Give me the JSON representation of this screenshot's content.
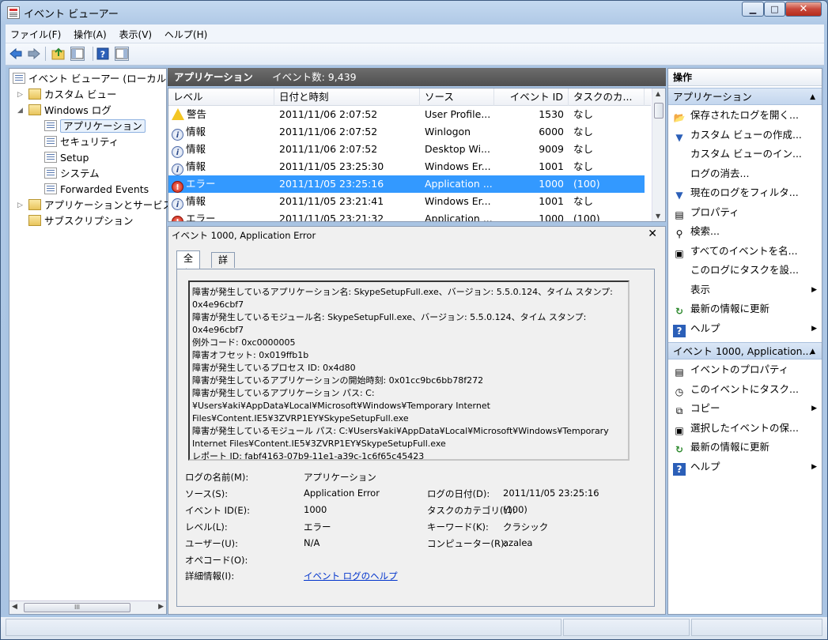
{
  "window": {
    "title": "イベント ビューアー",
    "min": "▁",
    "max": "□",
    "close": "✕"
  },
  "menu": [
    "ファイル(F)",
    "操作(A)",
    "表示(V)",
    "ヘルプ(H)"
  ],
  "toolbar": {
    "icons": [
      "back-icon",
      "forward-icon",
      "up-folder-icon",
      "show-hide-tree-icon",
      "help-icon",
      "show-hide-action-icon"
    ]
  },
  "tree": {
    "root": "イベント ビューアー (ローカル",
    "custom_views": "カスタム ビュー",
    "windows_logs": "Windows ログ",
    "application": "アプリケーション",
    "security": "セキュリティ",
    "setup": "Setup",
    "system": "システム",
    "forwarded": "Forwarded Events",
    "apps_services": "アプリケーションとサービス",
    "subscriptions": "サブスクリプション",
    "scroll_thumb": "III"
  },
  "list": {
    "header_title": "アプリケーション",
    "header_count": "イベント数: 9,439",
    "columns": [
      "レベル",
      "日付と時刻",
      "ソース",
      "イベント ID",
      "タスクのカ..."
    ],
    "rows": [
      {
        "level": "警告",
        "icon": "warning-icon",
        "date": "2011/11/06 2:07:52",
        "source": "User Profile...",
        "id": "1530",
        "task": "なし"
      },
      {
        "level": "情報",
        "icon": "info-icon",
        "date": "2011/11/06 2:07:52",
        "source": "Winlogon",
        "id": "6000",
        "task": "なし"
      },
      {
        "level": "情報",
        "icon": "info-icon",
        "date": "2011/11/06 2:07:52",
        "source": "Desktop Wi...",
        "id": "9009",
        "task": "なし"
      },
      {
        "level": "情報",
        "icon": "info-icon",
        "date": "2011/11/05 23:25:30",
        "source": "Windows Er...",
        "id": "1001",
        "task": "なし"
      },
      {
        "level": "エラー",
        "icon": "error-icon",
        "date": "2011/11/05 23:25:16",
        "source": "Application ...",
        "id": "1000",
        "task": "(100)"
      },
      {
        "level": "情報",
        "icon": "info-icon",
        "date": "2011/11/05 23:21:41",
        "source": "Windows Er...",
        "id": "1001",
        "task": "なし"
      },
      {
        "level": "エラー",
        "icon": "error-icon",
        "date": "2011/11/05 23:21:32",
        "source": "Application ...",
        "id": "1000",
        "task": "(100)"
      }
    ]
  },
  "detail": {
    "title": "イベント 1000, Application Error",
    "close": "✕",
    "tab_general": "全般",
    "tab_details": "詳細",
    "description": "障害が発生しているアプリケーション名: SkypeSetupFull.exe、バージョン: 5.5.0.124、タイム スタンプ: 0x4e96cbf7\n障害が発生しているモジュール名: SkypeSetupFull.exe、バージョン: 5.5.0.124、タイム スタンプ: 0x4e96cbf7\n例外コード: 0xc0000005\n障害オフセット: 0x019ffb1b\n障害が発生しているプロセス ID: 0x4d80\n障害が発生しているアプリケーションの開始時刻: 0x01cc9bc6bb78f272\n障害が発生しているアプリケーション パス: C:¥Users¥aki¥AppData¥Local¥Microsoft¥Windows¥Temporary Internet Files¥Content.IE5¥3ZVRP1EY¥SkypeSetupFull.exe\n障害が発生しているモジュール パス: C:¥Users¥aki¥AppData¥Local¥Microsoft¥Windows¥Temporary Internet Files¥Content.IE5¥3ZVRP1EY¥SkypeSetupFull.exe\nレポート ID: fabf4163-07b9-11e1-a39c-1c6f65c45423",
    "log_name_label": "ログの名前(M):",
    "log_name": "アプリケーション",
    "source_label": "ソース(S):",
    "source": "Application Error",
    "logged_label": "ログの日付(D):",
    "logged": "2011/11/05 23:25:16",
    "event_id_label": "イベント ID(E):",
    "event_id": "1000",
    "task_label": "タスクのカテゴリ(Y):",
    "task": "(100)",
    "level_label": "レベル(L):",
    "level": "エラー",
    "keywords_label": "キーワード(K):",
    "keywords": "クラシック",
    "user_label": "ユーザー(U):",
    "user": "N/A",
    "computer_label": "コンピューター(R):",
    "computer": "azalea",
    "opcode_label": "オペコード(O):",
    "more_info_label": "詳細情報(I):",
    "more_info_link": "イベント ログのヘルプ"
  },
  "actions": {
    "header": "操作",
    "section1": "アプリケーション",
    "items1": [
      {
        "label": "保存されたログを開く...",
        "icon": "open-folder-icon",
        "glyph": "📂",
        "sub": false
      },
      {
        "label": "カスタム ビューの作成...",
        "icon": "filter-icon",
        "glyph": "▼",
        "sub": false
      },
      {
        "label": "カスタム ビューのイン...",
        "icon": "",
        "glyph": "",
        "sub": false
      },
      {
        "label": "ログの消去...",
        "icon": "",
        "glyph": "",
        "sub": false
      },
      {
        "label": "現在のログをフィルタ...",
        "icon": "filter-icon",
        "glyph": "▼",
        "sub": false
      },
      {
        "label": "プロパティ",
        "icon": "properties-icon",
        "glyph": "▤",
        "sub": false
      },
      {
        "label": "検索...",
        "icon": "binoculars-icon",
        "glyph": "⚲",
        "sub": false
      },
      {
        "label": "すべてのイベントを名...",
        "icon": "save-icon",
        "glyph": "▣",
        "sub": false
      },
      {
        "label": "このログにタスクを設...",
        "icon": "",
        "glyph": "",
        "sub": false
      },
      {
        "label": "表示",
        "icon": "",
        "glyph": "",
        "sub": true
      },
      {
        "label": "最新の情報に更新",
        "icon": "refresh-icon",
        "glyph": "↻",
        "sub": false
      },
      {
        "label": "ヘルプ",
        "icon": "help-icon",
        "glyph": "?",
        "sub": true
      }
    ],
    "section2": "イベント 1000, Application...",
    "items2": [
      {
        "label": "イベントのプロパティ",
        "icon": "properties-icon",
        "glyph": "▤",
        "sub": false
      },
      {
        "label": "このイベントにタスク...",
        "icon": "task-icon",
        "glyph": "◷",
        "sub": false
      },
      {
        "label": "コピー",
        "icon": "copy-icon",
        "glyph": "⧉",
        "sub": true
      },
      {
        "label": "選択したイベントの保...",
        "icon": "save-icon",
        "glyph": "▣",
        "sub": false
      },
      {
        "label": "最新の情報に更新",
        "icon": "refresh-icon",
        "glyph": "↻",
        "sub": false
      },
      {
        "label": "ヘルプ",
        "icon": "help-icon",
        "glyph": "?",
        "sub": true
      }
    ]
  },
  "colors": {
    "selection": "#3399ff",
    "link": "#0033cc"
  }
}
